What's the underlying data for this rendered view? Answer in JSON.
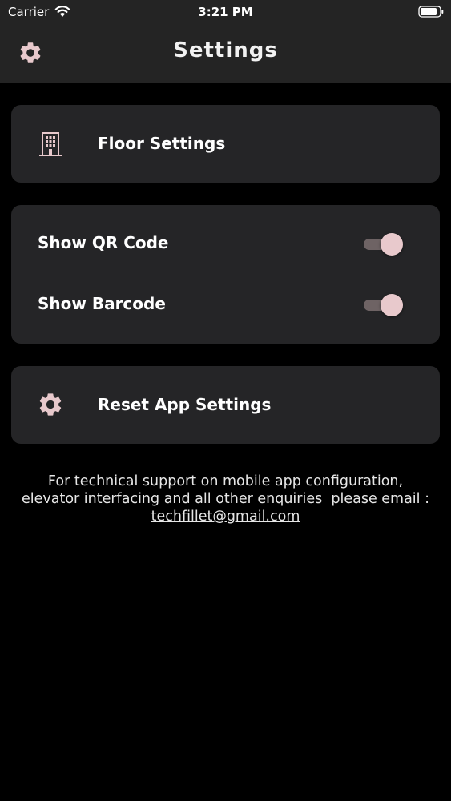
{
  "status_bar": {
    "carrier": "Carrier",
    "time": "3:21 PM",
    "wifi_icon": "wifi-icon",
    "battery_icon": "battery-icon"
  },
  "navbar": {
    "title": "Settings",
    "left_icon": "gear-icon"
  },
  "floor_card": {
    "icon": "building-icon",
    "label": "Floor Settings"
  },
  "toggles": [
    {
      "label": "Show QR Code",
      "on": true
    },
    {
      "label": "Show Barcode",
      "on": true
    }
  ],
  "reset_card": {
    "icon": "gear-icon",
    "label": "Reset App Settings"
  },
  "support": {
    "line1": "For technical support on mobile app configuration,",
    "line2": "elevator interfacing and all other enquiries  please email :",
    "email": "techfillet@gmail.com"
  },
  "colors": {
    "background": "#000000",
    "bar": "#242424",
    "card": "#252527",
    "icon": "#e8c9cc",
    "switch_track": "#6e6364",
    "switch_thumb": "#e8c9cc"
  }
}
